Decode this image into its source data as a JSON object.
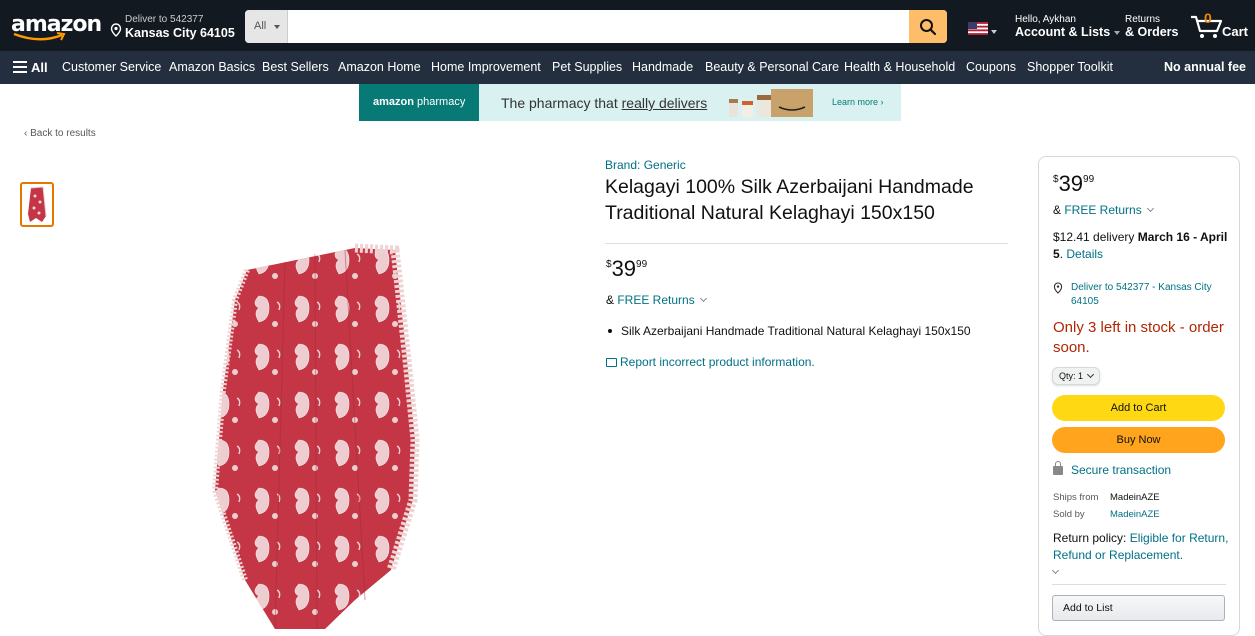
{
  "header": {
    "logo": "amazon",
    "deliver_line1": "Deliver to 542377",
    "deliver_line2": "Kansas City 64105",
    "search_category": "All",
    "search_placeholder": "",
    "account_line1": "Hello, Aykhan",
    "account_line2": "Account & Lists",
    "returns_line1": "Returns",
    "returns_line2": "& Orders",
    "cart_count": "0",
    "cart_label": "Cart",
    "accent_color": "#febd69"
  },
  "nav": {
    "all_label": "All",
    "items": [
      "Customer Service",
      "Amazon Basics",
      "Best Sellers",
      "Amazon Home",
      "Home Improvement",
      "Pet Supplies",
      "Handmade",
      "Beauty & Personal Care",
      "Health & Household",
      "Coupons",
      "Shopper Toolkit"
    ],
    "right_label": "No annual fee"
  },
  "banner": {
    "logo_text": "amazon",
    "logo_sub": "pharmacy",
    "tagline_prefix": "The pharmacy that ",
    "tagline_underlined": "really delivers",
    "cta": "Learn more ›"
  },
  "back_link": "‹ Back to results",
  "product": {
    "brand": "Brand: Generic",
    "title": "Kelagayi 100% Silk Azerbaijani Handmade Traditional Natural Kelaghayi 150x150",
    "price_symbol": "$",
    "price_whole": "39",
    "price_fraction": "99",
    "free_returns_prefix": "& ",
    "free_returns": "FREE Returns",
    "bullets": [
      "Silk Azerbaijani Handmade Traditional Natural Kelaghayi 150x150"
    ],
    "report_link": "Report incorrect product information."
  },
  "buybox": {
    "delivery_price": "$12.41 delivery ",
    "delivery_dates": "March 16 - April 5",
    "delivery_period": ". ",
    "details_link": "Details",
    "deliver_to": "Deliver to 542377 - Kansas City 64105",
    "stock": "Only 3 left in stock - order soon.",
    "qty_label": "Qty: 1",
    "add_to_cart": "Add to Cart",
    "buy_now": "Buy Now",
    "secure": "Secure transaction",
    "ships_from_label": "Ships from",
    "ships_from_value": "MadeinAZE",
    "sold_by_label": "Sold by",
    "sold_by_value": "MadeinAZE",
    "return_policy_label": "Return policy: ",
    "return_policy_link": "Eligible for Return, Refund or Replacement.",
    "add_to_list": "Add to List"
  },
  "colors": {
    "topbar": "#131921",
    "navbar": "#232f3e",
    "link": "#007185",
    "stock": "#b12704",
    "add_to_cart": "#ffd814",
    "buy_now": "#ffa41c",
    "scarf": "#c43545"
  },
  "icons": [
    "location-pin-icon",
    "search-icon",
    "us-flag-icon",
    "cart-icon",
    "hamburger-icon",
    "lock-icon",
    "report-icon",
    "chevron-down-icon"
  ]
}
